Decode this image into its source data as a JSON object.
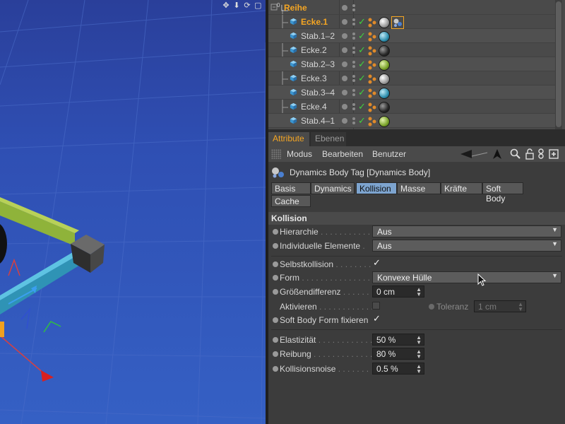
{
  "object_manager": {
    "parent": {
      "name": "Reihe",
      "level_label": "0"
    },
    "rows": [
      {
        "name": "Ecke.1",
        "material": "silver",
        "selected": true
      },
      {
        "name": "Stab.1–2",
        "material": "teal"
      },
      {
        "name": "Ecke.2",
        "material": "dark"
      },
      {
        "name": "Stab.2–3",
        "material": "green"
      },
      {
        "name": "Ecke.3",
        "material": "silver"
      },
      {
        "name": "Stab.3–4",
        "material": "teal"
      },
      {
        "name": "Ecke.4",
        "material": "dark"
      },
      {
        "name": "Stab.4–1",
        "material": "green"
      }
    ]
  },
  "attribute_manager": {
    "tabs": [
      "Attribute",
      "Ebenen"
    ],
    "menu": [
      "Modus",
      "Bearbeiten",
      "Benutzer"
    ],
    "tag_title": "Dynamics Body Tag [Dynamics Body]",
    "property_tabs_row1": [
      "Basis",
      "Dynamics",
      "Kollision",
      "Masse",
      "Kräfte",
      "Soft Body"
    ],
    "property_tabs_row2": [
      "Cache"
    ],
    "active_property_tab": "Kollision",
    "section": "Kollision",
    "hierarchie": {
      "label": "Hierarchie",
      "value": "Aus"
    },
    "individuelle": {
      "label": "Individuelle Elemente",
      "value": "Aus"
    },
    "selbstkollision": {
      "label": "Selbstkollision",
      "checked": true
    },
    "form": {
      "label": "Form",
      "value": "Konvexe Hülle"
    },
    "groessendifferenz": {
      "label": "Größendifferenz",
      "value": "0 cm"
    },
    "aktivieren": {
      "label": "Aktivieren",
      "checked": false
    },
    "toleranz": {
      "label": "Toleranz",
      "value": "1 cm"
    },
    "softbody_form": {
      "label": "Soft Body Form fixieren",
      "checked": true
    },
    "elastizitaet": {
      "label": "Elastizität",
      "value": "50 %"
    },
    "reibung": {
      "label": "Reibung",
      "value": "80 %"
    },
    "kollisionsnoise": {
      "label": "Kollisionsnoise",
      "value": "0.5 %"
    }
  },
  "colors": {
    "accent": "#f5a623",
    "active_tab": "#7da4cf",
    "check_green": "#3fd13f",
    "viewport_blue": "#2f4fb3"
  },
  "icons": {
    "viewport_nav": [
      "move-icon",
      "zoom-icon",
      "rotate-icon",
      "maximize-icon"
    ],
    "menubar": [
      "back-arrow-icon",
      "up-arrow-icon",
      "search-icon",
      "lock-icon",
      "link-icon",
      "new-window-icon"
    ]
  }
}
